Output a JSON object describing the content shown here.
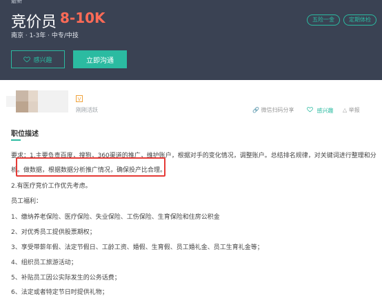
{
  "header": {
    "top_hint": "最新",
    "title": "竞价员",
    "salary": "8-10K",
    "meta": "南京 · 1-3年 · 中专/中技",
    "tags": [
      "五险一金",
      "定期体检"
    ],
    "buttons": {
      "interest_label": "感兴趣",
      "contact_label": "立即沟通"
    }
  },
  "employer": {
    "badge": "V",
    "active": "刚刚活跃",
    "actions": {
      "share": "微信扫码分享",
      "fav": "感兴趣",
      "report": "举报"
    }
  },
  "description": {
    "section_title": "职位描述",
    "lines": [
      "要求：1.主要负责百度，搜狗，360渠道的推广，维护账户，根据对手的变化情况，调整账户。总结排名规律，对关键词进行整理和分",
      "析。做数据，根据数据分析推广情况，确保投产比合理。",
      "2.有医疗竞价工作优先考虑。",
      "员工福利：",
      "1、缴纳养老保险、医疗保险、失业保险、工伤保险、生育保险和住房公积金",
      "2、对优秀员工提供股票期权；",
      "3、享受带薪年假、法定节假日、工龄工资、婚假、生育假、员工婚礼金、员工生育礼金等；",
      "4、组织员工旅游活动；",
      "5、补贴员工因公实际发生的公务话费；",
      "6、法定或者特定节日时提供礼物；"
    ]
  },
  "colors": {
    "header_bg": "#3a4253",
    "accent": "#2bbba1",
    "salary": "#ff6b57",
    "highlight_border": "#e53935"
  }
}
